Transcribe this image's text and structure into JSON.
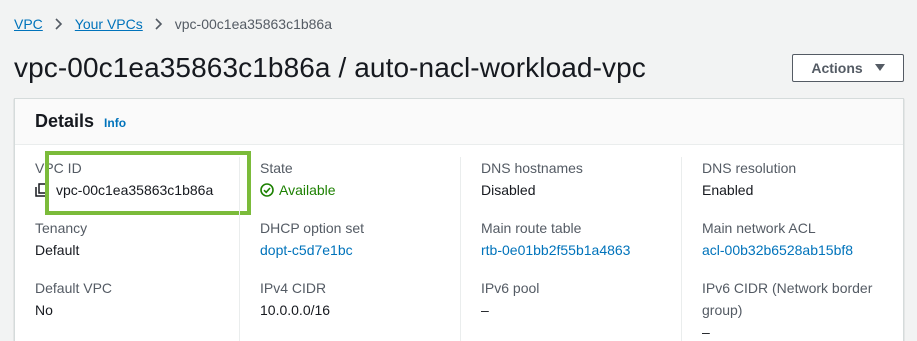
{
  "breadcrumb": {
    "items": [
      "VPC",
      "Your VPCs"
    ],
    "current": "vpc-00c1ea35863c1b86a"
  },
  "page": {
    "title": "vpc-00c1ea35863c1b86a / auto-nacl-workload-vpc",
    "actions_label": "Actions"
  },
  "details": {
    "title": "Details",
    "info_label": "Info",
    "columns": [
      [
        {
          "label": "VPC ID",
          "value": "vpc-00c1ea35863c1b86a"
        },
        {
          "label": "Tenancy",
          "value": "Default"
        },
        {
          "label": "Default VPC",
          "value": "No"
        }
      ],
      [
        {
          "label": "State",
          "value": "Available"
        },
        {
          "label": "DHCP option set",
          "value": "dopt-c5d7e1bc"
        },
        {
          "label": "IPv4 CIDR",
          "value": "10.0.0.0/16"
        }
      ],
      [
        {
          "label": "DNS hostnames",
          "value": "Disabled"
        },
        {
          "label": "Main route table",
          "value": "rtb-0e01bb2f55b1a4863"
        },
        {
          "label": "IPv6 pool",
          "value": "–"
        }
      ],
      [
        {
          "label": "DNS resolution",
          "value": "Enabled"
        },
        {
          "label": "Main network ACL",
          "value": "acl-00b32b6528ab15bf8"
        },
        {
          "label": "IPv6 CIDR (Network border group)",
          "value": "–"
        }
      ]
    ]
  },
  "colors": {
    "link": "#0073bb",
    "success": "#1d8102",
    "highlight": "#7bbb3a"
  }
}
